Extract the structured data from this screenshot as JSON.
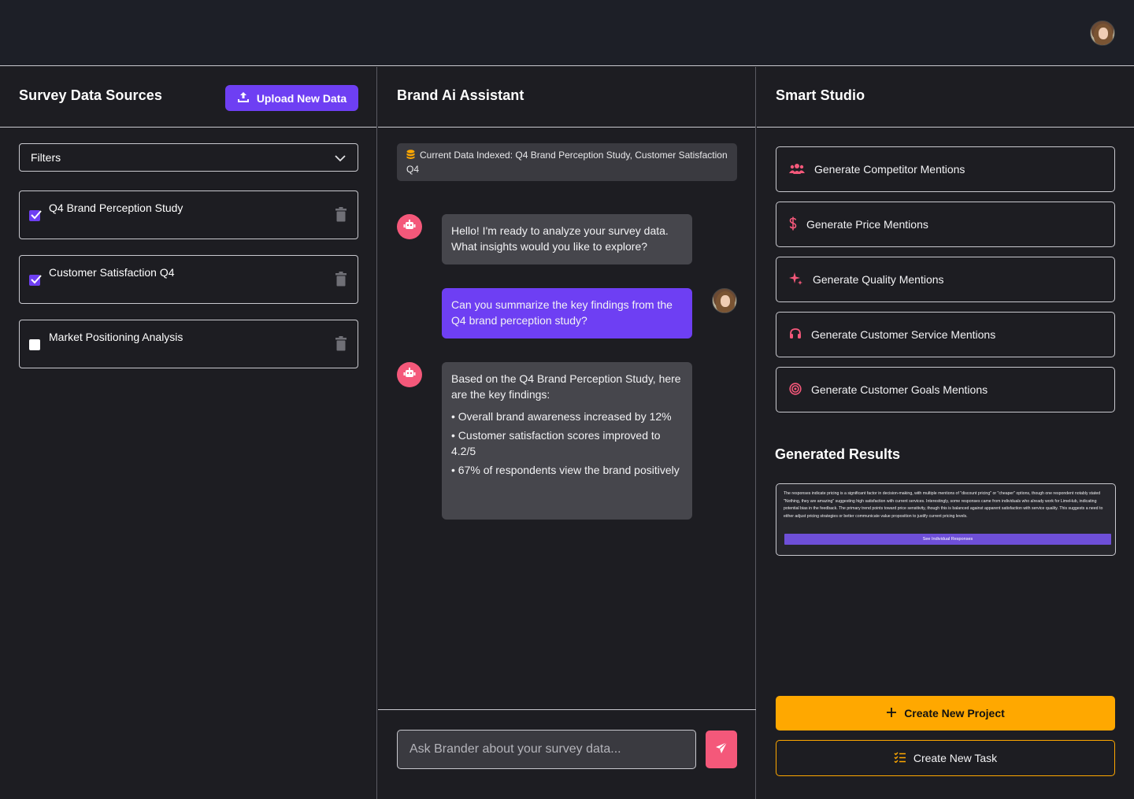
{
  "header": {
    "avatar_alt": "user avatar"
  },
  "left": {
    "title": "Survey Data Sources",
    "upload_label": "Upload New Data",
    "filters_label": "Filters",
    "sources": [
      {
        "label": "Q4 Brand Perception Study",
        "checked": true
      },
      {
        "label": "Customer Satisfaction Q4",
        "checked": true
      },
      {
        "label": "Market Positioning Analysis",
        "checked": false
      }
    ]
  },
  "mid": {
    "title": "Brand Ai Assistant",
    "indexed_text": "Current Data Indexed: Q4 Brand Perception Study, Customer Satisfaction Q4",
    "messages": [
      {
        "role": "bot",
        "text": "Hello! I'm ready to analyze your survey data. What insights would you like to explore?"
      },
      {
        "role": "user",
        "text": "Can you summarize the key findings from the Q4 brand perception study?"
      },
      {
        "role": "bot",
        "intro": "Based on the Q4 Brand Perception Study, here are the key findings:",
        "points": [
          "• Overall brand awareness increased by 12%",
          "• Customer satisfaction scores improved to 4.2/5",
          "• 67% of respondents view the brand positively"
        ]
      }
    ],
    "input_placeholder": "Ask Brander about your survey data..."
  },
  "right": {
    "title": "Smart Studio",
    "generators": [
      {
        "label": "Generate Competitor Mentions",
        "icon": "users-icon"
      },
      {
        "label": "Generate Price Mentions",
        "icon": "dollar-icon"
      },
      {
        "label": "Generate Quality Mentions",
        "icon": "sparkles-icon"
      },
      {
        "label": "Generate Customer Service Mentions",
        "icon": "headset-icon"
      },
      {
        "label": "Generate Customer Goals Mentions",
        "icon": "target-icon"
      }
    ],
    "results_title": "Generated Results",
    "result_text": "The responses indicate pricing is a significant factor in decision-making, with multiple mentions of \"discount pricing\" or \"cheaper\" options, though one respondent notably stated \"Nothing, they are amazing\" suggesting high satisfaction with current services. Interestingly, some responses came from individuals who already work for LimeHub, indicating potential bias in the feedback. The primary trend points toward price sensitivity, though this is balanced against apparent satisfaction with service quality. This suggests a need to either adjust pricing strategies or better communicate value proposition to justify current pricing levels.",
    "see_responses_label": "See Individual Responses",
    "create_project_label": "Create New Project",
    "create_task_label": "Create New Task"
  },
  "colors": {
    "accent": "#6e3ff3",
    "pink": "#f4587a",
    "orange": "#ffa800",
    "bg": "#1d1d22"
  }
}
